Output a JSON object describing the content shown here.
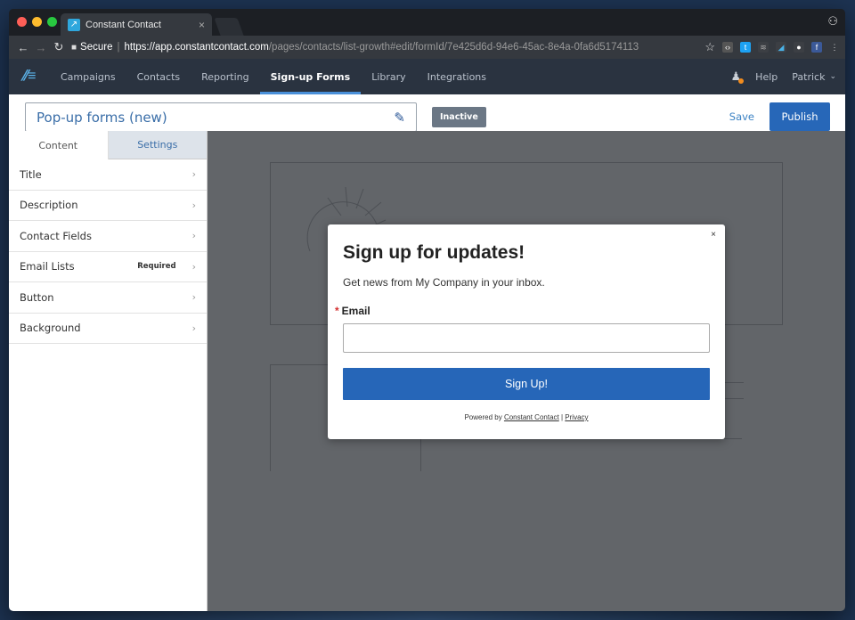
{
  "browser": {
    "tab_title": "Constant Contact",
    "tab_close": "×",
    "url_secure_label": "Secure",
    "url_main": "https://app.constantcontact.com",
    "url_rest": "/pages/contacts/list-growth#edit/formId/7e425d6d-94e6-45ac-8e4a-0fa6d5174113"
  },
  "appnav": {
    "items": [
      "Campaigns",
      "Contacts",
      "Reporting",
      "Sign-up Forms",
      "Library",
      "Integrations"
    ],
    "active": "Sign-up Forms",
    "help": "Help",
    "user": "Patrick"
  },
  "header": {
    "form_title": "Pop-up forms (new)",
    "status_badge": "Inactive",
    "save": "Save",
    "publish": "Publish"
  },
  "sidebar": {
    "tabs": [
      "Content",
      "Settings"
    ],
    "rows": [
      {
        "label": "Title",
        "badge": ""
      },
      {
        "label": "Description",
        "badge": ""
      },
      {
        "label": "Contact Fields",
        "badge": ""
      },
      {
        "label": "Email Lists",
        "badge": "Required"
      },
      {
        "label": "Button",
        "badge": ""
      },
      {
        "label": "Background",
        "badge": ""
      }
    ]
  },
  "modal": {
    "close": "×",
    "title": "Sign up for updates!",
    "description": "Get news from My Company in your inbox.",
    "email_label": "Email",
    "required_marker": "*",
    "email_value": "",
    "button_label": "Sign Up!",
    "footer_prefix": "Powered by",
    "footer_link1": "Constant Contact",
    "footer_sep": "|",
    "footer_link2": "Privacy"
  },
  "colors": {
    "accent": "#2767b8",
    "nav_bg": "#2a3340",
    "canvas_bg": "#626569"
  }
}
